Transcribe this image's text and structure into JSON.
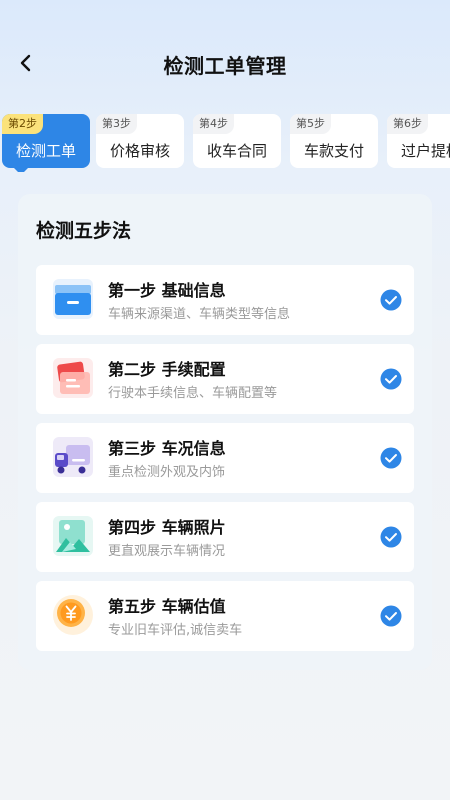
{
  "header": {
    "title": "检测工单管理",
    "back_icon": "chevron-left-icon"
  },
  "steps": [
    {
      "badge": "第2步",
      "label": "检测工单",
      "active": true
    },
    {
      "badge": "第3步",
      "label": "价格审核",
      "active": false
    },
    {
      "badge": "第4步",
      "label": "收车合同",
      "active": false
    },
    {
      "badge": "第5步",
      "label": "车款支付",
      "active": false
    },
    {
      "badge": "第6步",
      "label": "过户提档",
      "active": false
    }
  ],
  "panel": {
    "title": "检测五步法",
    "items": [
      {
        "title": "第一步 基础信息",
        "desc": "车辆来源渠道、车辆类型等信息",
        "icon": "inbox-tray-icon",
        "checked": true
      },
      {
        "title": "第二步 手续配置",
        "desc": "行驶本手续信息、车辆配置等",
        "icon": "document-cards-icon",
        "checked": true
      },
      {
        "title": "第三步 车况信息",
        "desc": "重点检测外观及内饰",
        "icon": "truck-icon",
        "checked": true
      },
      {
        "title": "第四步 车辆照片",
        "desc": "更直观展示车辆情况",
        "icon": "photo-icon",
        "checked": true
      },
      {
        "title": "第五步 车辆估值",
        "desc": "专业旧车评估,诚信卖车",
        "icon": "yuan-coin-icon",
        "checked": true
      }
    ]
  },
  "colors": {
    "accent": "#2e86e6",
    "active_badge": "#fbe27b",
    "check": "#2e86e6"
  }
}
